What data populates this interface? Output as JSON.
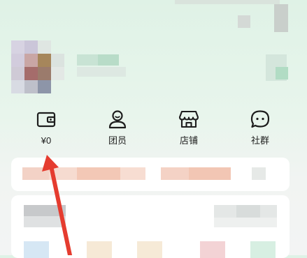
{
  "colors": {
    "accent_orange": "#f3c2ad",
    "arrow_red": "#e53c2f",
    "icon_stroke": "#1d1d1d",
    "text_primary": "#222222"
  },
  "quick_actions": [
    {
      "icon": "wallet-icon",
      "label": "¥0"
    },
    {
      "icon": "team-member-icon",
      "label": "团员"
    },
    {
      "icon": "store-icon",
      "label": "店铺"
    },
    {
      "icon": "community-chat-icon",
      "label": "社群"
    }
  ]
}
